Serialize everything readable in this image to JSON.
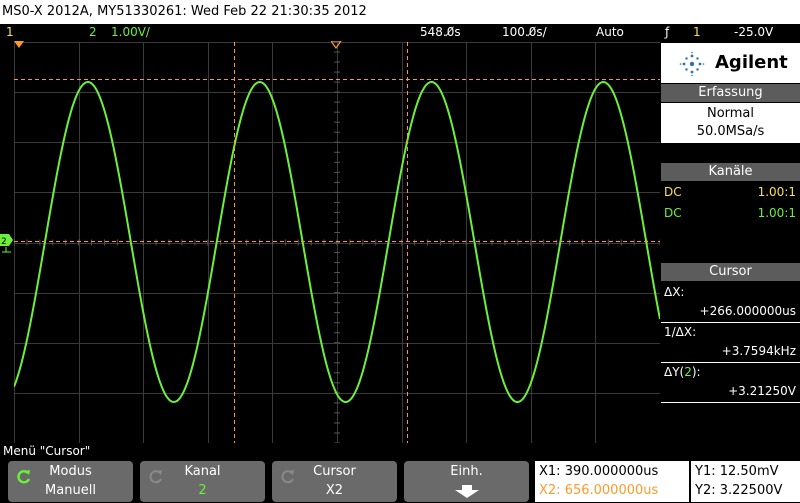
{
  "title_bar": "MS0-X 2012A, MY51330261: Wed Feb 22 21:30:35 2012",
  "status": {
    "ch1_number": "1",
    "ch2_number": "2",
    "ch2_scale": "1.00V/",
    "time_delay": "548.0̸s",
    "time_scale": "100.0̸s/",
    "trigger_mode": "Auto",
    "trigger_symbol": "ƒ",
    "trigger_source": "1",
    "trigger_level": "-25.0V"
  },
  "panel": {
    "brand": "Agilent",
    "acquisition_header": "Erfassung",
    "acq_mode": "Normal",
    "sample_rate": "50.0MSa/s",
    "channels_header": "Kanäle",
    "channels": [
      {
        "coupling": "DC",
        "probe": "1.00:1",
        "color": "#ffe14a"
      },
      {
        "coupling": "DC",
        "probe": "1.00:1",
        "color": "#6cf03a"
      }
    ],
    "cursor_header": "Cursor",
    "dx_label": "ΔX:",
    "dx_value": "+266.000000us",
    "inv_dx_label": "1/ΔX:",
    "inv_dx_value": "+3.7594kHz",
    "dy_label_prefix": "ΔY(",
    "dy_channel": "2",
    "dy_label_suffix": "):",
    "dy_value": "+3.21250V"
  },
  "menu_label": "Menü \"Cursor\"",
  "softkeys": [
    {
      "title": "Modus",
      "value": "Manuell"
    },
    {
      "title": "Kanal",
      "value": "2"
    },
    {
      "title": "Cursor",
      "value": "X2"
    },
    {
      "title": "Einh.",
      "value": ""
    }
  ],
  "readouts": {
    "x1": "X1: 390.000000us",
    "x2": "X2: 656.000000us",
    "y1": "Y1: 12.50mV",
    "y2": "Y2: 3.22500V"
  },
  "waveform": {
    "cycles_visible": 3.76,
    "color": "#6cf03a"
  },
  "colors": {
    "ch1": "#ffe14a",
    "ch2": "#6cf03a",
    "cursor": "#ff9a2a",
    "grid": "#3a3a3a"
  }
}
